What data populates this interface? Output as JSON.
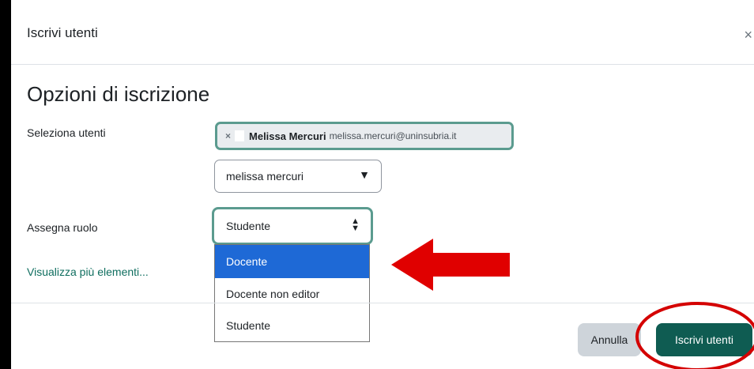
{
  "modal": {
    "title": "Iscrivi utenti",
    "close_glyph": "×"
  },
  "section": {
    "title": "Opzioni di iscrizione"
  },
  "select_users": {
    "label": "Seleziona utenti",
    "chip": {
      "remove_glyph": "×",
      "name": "Melissa Mercuri",
      "email": "melissa.mercuri@uninsubria.it"
    },
    "search_value": "melissa mercuri",
    "search_arrow": "▼"
  },
  "role": {
    "label": "Assegna ruolo",
    "selected": "Studente",
    "arrows": "⬍",
    "options": [
      "Docente",
      "Docente non editor",
      "Studente"
    ],
    "highlighted_index": 0
  },
  "show_more_link": "Visualizza più elementi...",
  "footer": {
    "cancel_label": "Annulla",
    "submit_label": "Iscrivi utenti"
  },
  "annotations": {
    "arrow_color": "#e00000",
    "circle_color": "#d40000"
  },
  "colors": {
    "accent": "#0f5c52",
    "focus_border": "#5b9b8f",
    "highlight": "#1e69d6"
  }
}
